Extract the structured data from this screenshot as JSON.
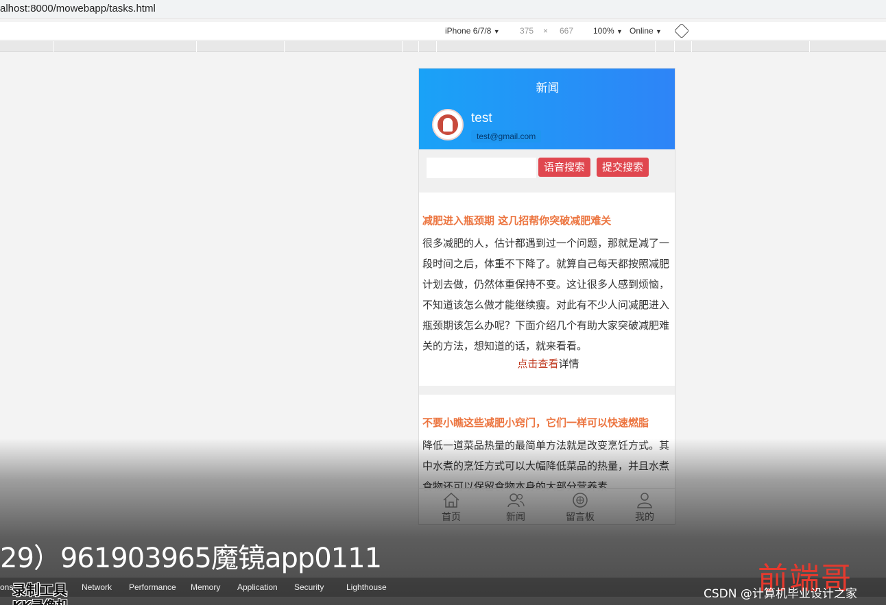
{
  "browser": {
    "url": "alhost:8000/mowebapp/tasks.html"
  },
  "device_toolbar": {
    "device": "iPhone 6/7/8",
    "width": "375",
    "times": "×",
    "height": "667",
    "zoom": "100%",
    "network": "Online",
    "caret": "▼"
  },
  "app": {
    "header_title": "新闻",
    "username": "test",
    "email": "test@gmail.com",
    "search": {
      "placeholder": "",
      "voice_button": "语音搜索",
      "submit_button": "提交搜索"
    },
    "articles": [
      {
        "title": "减肥进入瓶颈期 这几招帮你突破减肥难关",
        "body": "很多减肥的人，估计都遇到过一个问题，那就是减了一段时间之后，体重不下降了。就算自己每天都按照减肥计划去做，仍然体重保持不变。这让很多人感到烦恼，不知道该怎么做才能继续瘦。对此有不少人问减肥进入瓶颈期该怎么办呢？下面介绍几个有助大家突破减肥难关的方法，想知道的话，就来看看。",
        "more_link": "点击查看",
        "more_suffix": "详情"
      },
      {
        "title": "不要小瞧这些减肥小窍门，它们一样可以快速燃脂",
        "body": "降低一道菜品热量的最简单方法就是改变烹饪方式。其中水煮的烹饪方式可以大幅降低菜品的热量，并且水煮食物还可以保留食物本身的大部分营养素"
      }
    ],
    "tabbar": [
      {
        "label": "首页",
        "icon": "home-icon"
      },
      {
        "label": "新闻",
        "icon": "news-icon"
      },
      {
        "label": "留言板",
        "icon": "message-board-icon"
      },
      {
        "label": "我的",
        "icon": "user-icon"
      }
    ]
  },
  "overlay": {
    "caption": "29）961903965魔镜app0111"
  },
  "devtools_tabs": [
    "onsole",
    "Network",
    "Performance",
    "Memory",
    "Application",
    "Security",
    "Lighthouse"
  ],
  "watermarks": {
    "recorder": "录制工具",
    "recorder_sub": "KK录像机",
    "brand": "前端哥",
    "csdn": "CSDN @计算机毕业设计之家"
  }
}
